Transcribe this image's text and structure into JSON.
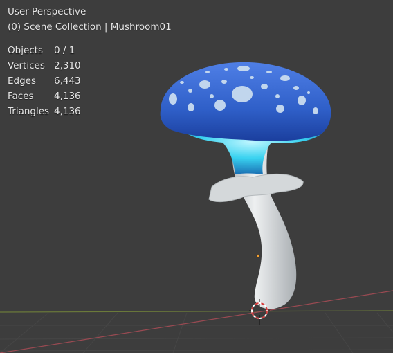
{
  "viewport": {
    "view_name": "User Perspective",
    "collection_line": "(0) Scene Collection | Mushroom01"
  },
  "stats": [
    {
      "label": "Objects",
      "value": "0 / 1"
    },
    {
      "label": "Vertices",
      "value": "2,310"
    },
    {
      "label": "Edges",
      "value": "6,443"
    },
    {
      "label": "Faces",
      "value": "4,136"
    },
    {
      "label": "Triangles",
      "value": "4,136"
    }
  ],
  "colors": {
    "background": "#3d3d3d",
    "grid": "#474747",
    "x_axis": "#9a4a52",
    "y_axis": "#6b7a3a",
    "cap": "#2f5fc8",
    "gills": "#39d2f0",
    "stem": "#dcdfe0",
    "cursor_red": "#d63b3b"
  },
  "icons": [
    "3d-cursor-icon",
    "origin-point-icon"
  ]
}
